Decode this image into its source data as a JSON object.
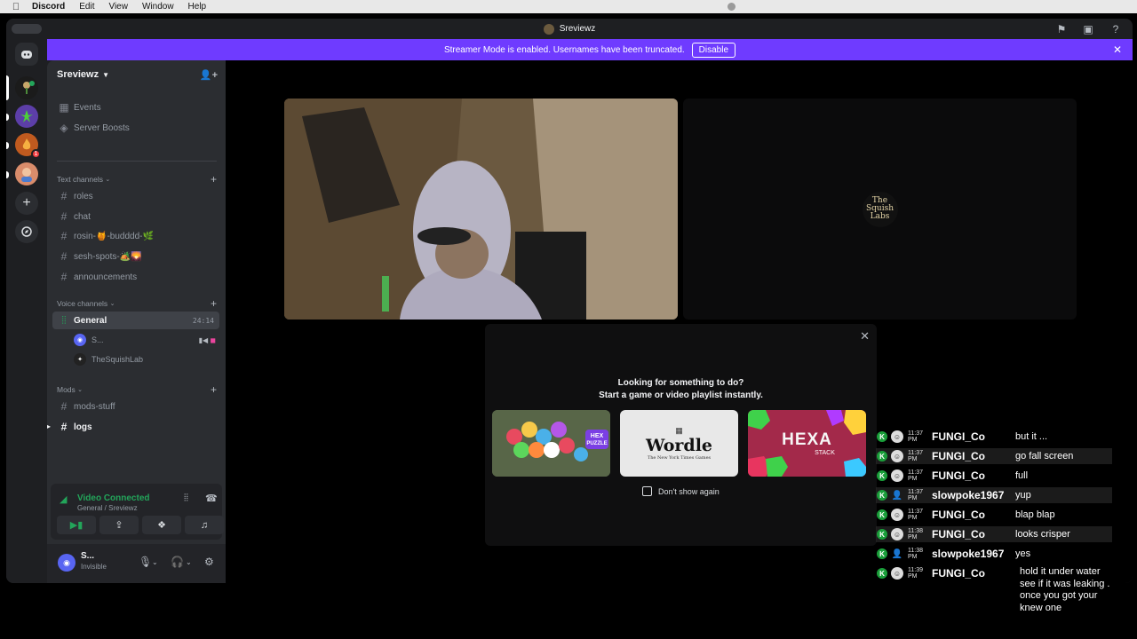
{
  "menubar": {
    "apple": "",
    "app": "Discord",
    "items": [
      "Edit",
      "View",
      "Window",
      "Help"
    ]
  },
  "window": {
    "title": "Sreviewz"
  },
  "banner": {
    "text": "Streamer Mode is enabled. Usernames have been truncated.",
    "button": "Disable"
  },
  "server": {
    "name": "Sreviewz",
    "top_items": [
      {
        "label": "Events",
        "icon": "calendar-icon"
      },
      {
        "label": "Server Boosts",
        "icon": "boost-icon"
      }
    ],
    "text_category": "Text channels",
    "text_channels": [
      "roles",
      "chat",
      "rosin-🍯-budddd-🌿",
      "sesh-spots-🏕️🌄",
      "announcements"
    ],
    "voice_category": "Voice channels",
    "voice_channel": {
      "name": "General",
      "timer": "24:14"
    },
    "voice_users": [
      {
        "name": "S...",
        "avatar": "discord-avatar"
      },
      {
        "name": "TheSquishLab",
        "avatar": "squishlab-avatar"
      }
    ],
    "mods_category": "Mods",
    "mods_channels": [
      "mods-stuff",
      "logs"
    ]
  },
  "voice_panel": {
    "status": "Video Connected",
    "location": "General / Sreviewz"
  },
  "user_panel": {
    "name": "S...",
    "status": "Invisible"
  },
  "stage": {
    "logo_text": "The Squish Labs"
  },
  "activity": {
    "line1": "Looking for something to do?",
    "line2": "Start a game or video playlist instantly.",
    "cards": [
      {
        "name": "Hex Puzzle",
        "label": "HEX PUZZLE"
      },
      {
        "name": "Wordle",
        "label": "Wordle",
        "sub": "The New York Times Games"
      },
      {
        "name": "Hexa Stack",
        "label": "HEXA",
        "sub": "STACK"
      }
    ],
    "dont_show": "Don't show again"
  },
  "chat": {
    "messages": [
      {
        "time": "11:37 PM",
        "user": "FUNGI_Co",
        "text": "but it ..."
      },
      {
        "time": "11:37 PM",
        "user": "FUNGI_Co",
        "text": "go fall screen"
      },
      {
        "time": "11:37 PM",
        "user": "FUNGI_Co",
        "text": "full"
      },
      {
        "time": "11:37 PM",
        "user": "slowpoke1967",
        "text": "yup"
      },
      {
        "time": "11:37 PM",
        "user": "FUNGI_Co",
        "text": "blap blap"
      },
      {
        "time": "11:38 PM",
        "user": "FUNGI_Co",
        "text": "looks crisper"
      },
      {
        "time": "11:38 PM",
        "user": "slowpoke1967",
        "text": "yes"
      },
      {
        "time": "11:39 PM",
        "user": "FUNGI_Co",
        "text": ""
      }
    ],
    "long_message": "hold it under water see if it was leaking . once you got your knew one"
  },
  "colors": {
    "accent": "#6f3bff",
    "connected": "#23a55a",
    "mention": "#f23f43"
  }
}
